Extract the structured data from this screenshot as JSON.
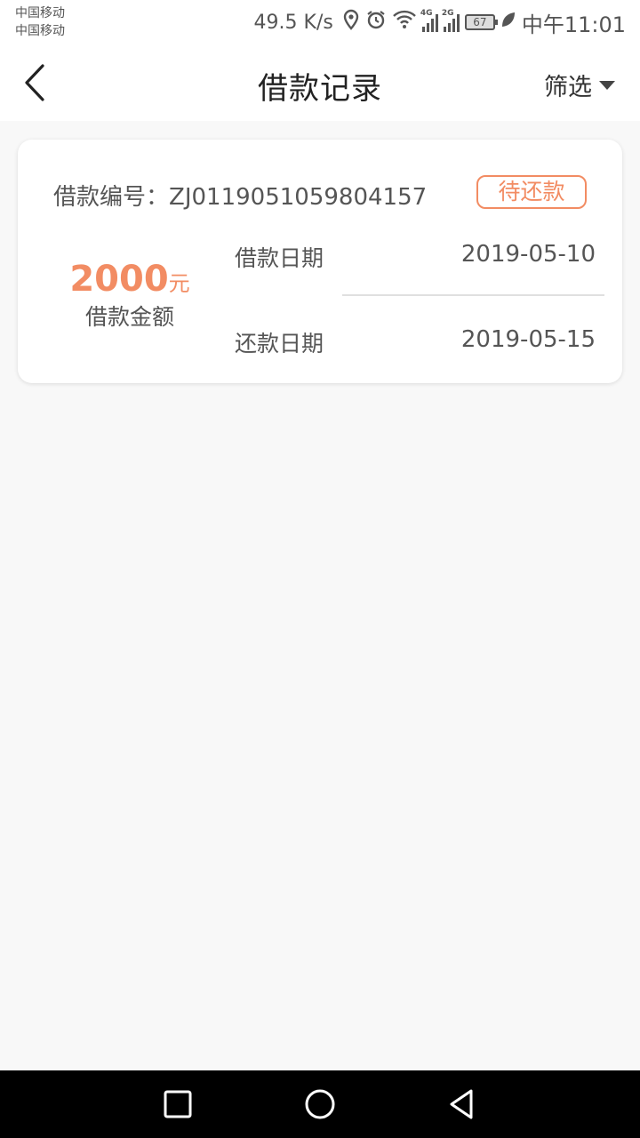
{
  "status_bar": {
    "carrier_1": "中国移动",
    "carrier_2": "中国移动",
    "net_speed": "49.5 K/s",
    "signal_1": "4G",
    "signal_2": "2G",
    "battery": "67",
    "time": "中午11:01"
  },
  "header": {
    "title": "借款记录",
    "filter_label": "筛选"
  },
  "loan": {
    "number_label": "借款编号：",
    "number": "ZJ0119051059804157",
    "status": "待还款",
    "amount": "2000",
    "amount_unit": "元",
    "amount_label": "借款金额",
    "loan_date_label": "借款日期",
    "loan_date": "2019-05-10",
    "repay_date_label": "还款日期",
    "repay_date": "2019-05-15"
  },
  "colors": {
    "accent": "#f28c63",
    "background": "#f8f8f8"
  }
}
